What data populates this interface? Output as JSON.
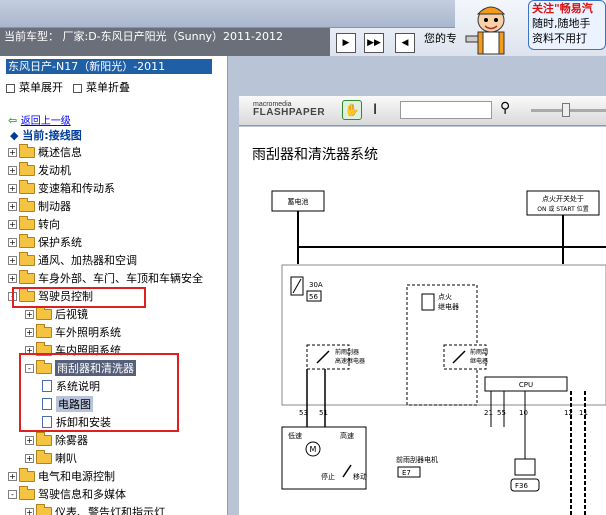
{
  "header": {
    "car_model": "当前车型：  厂家:D-东风日产阳光（Sunny）2011-2012",
    "ad_text": "您的专",
    "ad_box_title": "关注\"畅易汽",
    "ad_box_line1": "随时,随地手",
    "ad_box_line2": "资料不用打"
  },
  "tree": {
    "header": "东风日产-N17（新阳光）-2011",
    "menu_expand": "菜单展开",
    "menu_collapse": "菜单折叠",
    "back": "返回上一级",
    "current": "当前:接线图",
    "items": [
      {
        "label": "概述信息",
        "exp": "+"
      },
      {
        "label": "发动机",
        "exp": "+"
      },
      {
        "label": "变速箱和传动系",
        "exp": "+"
      },
      {
        "label": "制动器",
        "exp": "+"
      },
      {
        "label": "转向",
        "exp": "+"
      },
      {
        "label": "保护系统",
        "exp": "+"
      },
      {
        "label": "通风、加热器和空调",
        "exp": "+"
      },
      {
        "label": "车身外部、车门、车顶和车辆安全",
        "exp": "+"
      },
      {
        "label": "驾驶员控制",
        "exp": "-"
      },
      {
        "label": "后视镜",
        "exp": "+"
      },
      {
        "label": "车外照明系统",
        "exp": "+"
      },
      {
        "label": "车内照明系统",
        "exp": "+"
      },
      {
        "label": "雨刮器和清洗器",
        "exp": "-"
      },
      {
        "label": "系统说明",
        "exp": ""
      },
      {
        "label": "电路图",
        "exp": ""
      },
      {
        "label": "拆卸和安装",
        "exp": ""
      },
      {
        "label": "除雾器",
        "exp": "+"
      },
      {
        "label": "喇叭",
        "exp": "+"
      },
      {
        "label": "电气和电源控制",
        "exp": "+"
      },
      {
        "label": "驾驶信息和多媒体",
        "exp": "-"
      },
      {
        "label": "仪表、警告灯和指示灯",
        "exp": "+"
      }
    ]
  },
  "viewer": {
    "logo_top": "macromedia",
    "logo_bottom": "FLASHPAPER",
    "title": "雨刮器和清洗器系统"
  },
  "diagram": {
    "label_top_left": "蓄电池",
    "label_top_right_1": "点火开关处于",
    "label_top_right_2": "ON 或 START 位置",
    "fuse_label": "30A",
    "fuse_num": "56",
    "relay1_a": "点火",
    "relay1_b": "继电器",
    "relay2_a": "前雨刮器",
    "relay2_b": "高速继电器",
    "relay3_a": "前雨刮",
    "relay3_b": "继电器",
    "cpu": "CPU",
    "pins": [
      "53",
      "51",
      "21",
      "55",
      "10",
      "12",
      "11"
    ],
    "motor_low": "低速",
    "motor_high": "高速",
    "motor_stop": "停止",
    "motor_move": "移动",
    "motor_name": "前雨刮器电机",
    "conn_e": "E7",
    "conn_f": "F36"
  },
  "colors": {
    "accent": "#1f5fa6",
    "highlight": "#e02020"
  }
}
